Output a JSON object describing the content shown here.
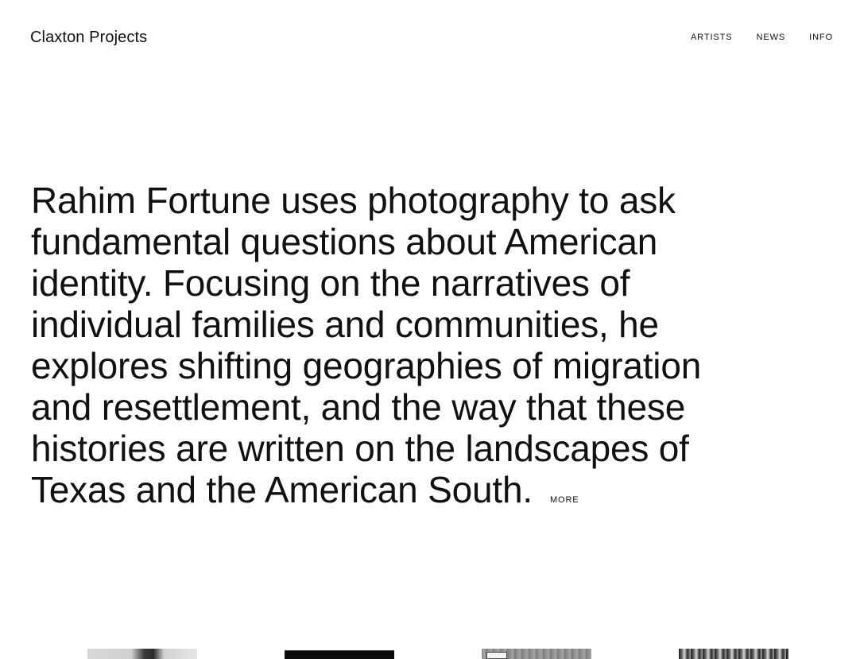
{
  "header": {
    "logo": "Claxton Projects",
    "nav": [
      {
        "label": "ARTISTS"
      },
      {
        "label": "NEWS"
      },
      {
        "label": "INFO"
      }
    ]
  },
  "main": {
    "bio_text": "Rahim Fortune uses photography to ask fundamental questions about American identity. Focusing on the narratives of individual families and communities, he explores shifting geographies of migration and resettlement, and the way that these histories are written on the landscapes of Texas and the American South.",
    "more_label": "MORE"
  },
  "thumbnails": [
    {
      "name": "artwork-thumbnail-1"
    },
    {
      "name": "artwork-thumbnail-2"
    },
    {
      "name": "artwork-thumbnail-3"
    },
    {
      "name": "artwork-thumbnail-4"
    }
  ]
}
